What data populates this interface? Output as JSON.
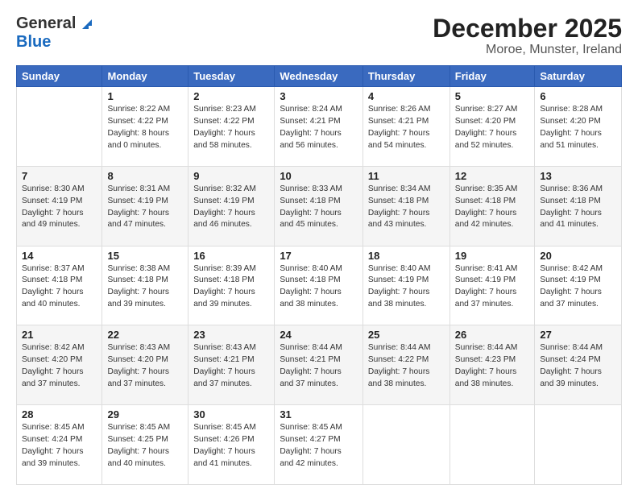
{
  "header": {
    "logo": {
      "line1": "General",
      "line2": "Blue"
    },
    "title": "December 2025",
    "location": "Moroe, Munster, Ireland"
  },
  "weekdays": [
    "Sunday",
    "Monday",
    "Tuesday",
    "Wednesday",
    "Thursday",
    "Friday",
    "Saturday"
  ],
  "weeks": [
    [
      {
        "day": "",
        "info": ""
      },
      {
        "day": "1",
        "info": "Sunrise: 8:22 AM\nSunset: 4:22 PM\nDaylight: 8 hours\nand 0 minutes."
      },
      {
        "day": "2",
        "info": "Sunrise: 8:23 AM\nSunset: 4:22 PM\nDaylight: 7 hours\nand 58 minutes."
      },
      {
        "day": "3",
        "info": "Sunrise: 8:24 AM\nSunset: 4:21 PM\nDaylight: 7 hours\nand 56 minutes."
      },
      {
        "day": "4",
        "info": "Sunrise: 8:26 AM\nSunset: 4:21 PM\nDaylight: 7 hours\nand 54 minutes."
      },
      {
        "day": "5",
        "info": "Sunrise: 8:27 AM\nSunset: 4:20 PM\nDaylight: 7 hours\nand 52 minutes."
      },
      {
        "day": "6",
        "info": "Sunrise: 8:28 AM\nSunset: 4:20 PM\nDaylight: 7 hours\nand 51 minutes."
      }
    ],
    [
      {
        "day": "7",
        "info": "Sunrise: 8:30 AM\nSunset: 4:19 PM\nDaylight: 7 hours\nand 49 minutes."
      },
      {
        "day": "8",
        "info": "Sunrise: 8:31 AM\nSunset: 4:19 PM\nDaylight: 7 hours\nand 47 minutes."
      },
      {
        "day": "9",
        "info": "Sunrise: 8:32 AM\nSunset: 4:19 PM\nDaylight: 7 hours\nand 46 minutes."
      },
      {
        "day": "10",
        "info": "Sunrise: 8:33 AM\nSunset: 4:18 PM\nDaylight: 7 hours\nand 45 minutes."
      },
      {
        "day": "11",
        "info": "Sunrise: 8:34 AM\nSunset: 4:18 PM\nDaylight: 7 hours\nand 43 minutes."
      },
      {
        "day": "12",
        "info": "Sunrise: 8:35 AM\nSunset: 4:18 PM\nDaylight: 7 hours\nand 42 minutes."
      },
      {
        "day": "13",
        "info": "Sunrise: 8:36 AM\nSunset: 4:18 PM\nDaylight: 7 hours\nand 41 minutes."
      }
    ],
    [
      {
        "day": "14",
        "info": "Sunrise: 8:37 AM\nSunset: 4:18 PM\nDaylight: 7 hours\nand 40 minutes."
      },
      {
        "day": "15",
        "info": "Sunrise: 8:38 AM\nSunset: 4:18 PM\nDaylight: 7 hours\nand 39 minutes."
      },
      {
        "day": "16",
        "info": "Sunrise: 8:39 AM\nSunset: 4:18 PM\nDaylight: 7 hours\nand 39 minutes."
      },
      {
        "day": "17",
        "info": "Sunrise: 8:40 AM\nSunset: 4:18 PM\nDaylight: 7 hours\nand 38 minutes."
      },
      {
        "day": "18",
        "info": "Sunrise: 8:40 AM\nSunset: 4:19 PM\nDaylight: 7 hours\nand 38 minutes."
      },
      {
        "day": "19",
        "info": "Sunrise: 8:41 AM\nSunset: 4:19 PM\nDaylight: 7 hours\nand 37 minutes."
      },
      {
        "day": "20",
        "info": "Sunrise: 8:42 AM\nSunset: 4:19 PM\nDaylight: 7 hours\nand 37 minutes."
      }
    ],
    [
      {
        "day": "21",
        "info": "Sunrise: 8:42 AM\nSunset: 4:20 PM\nDaylight: 7 hours\nand 37 minutes."
      },
      {
        "day": "22",
        "info": "Sunrise: 8:43 AM\nSunset: 4:20 PM\nDaylight: 7 hours\nand 37 minutes."
      },
      {
        "day": "23",
        "info": "Sunrise: 8:43 AM\nSunset: 4:21 PM\nDaylight: 7 hours\nand 37 minutes."
      },
      {
        "day": "24",
        "info": "Sunrise: 8:44 AM\nSunset: 4:21 PM\nDaylight: 7 hours\nand 37 minutes."
      },
      {
        "day": "25",
        "info": "Sunrise: 8:44 AM\nSunset: 4:22 PM\nDaylight: 7 hours\nand 38 minutes."
      },
      {
        "day": "26",
        "info": "Sunrise: 8:44 AM\nSunset: 4:23 PM\nDaylight: 7 hours\nand 38 minutes."
      },
      {
        "day": "27",
        "info": "Sunrise: 8:44 AM\nSunset: 4:24 PM\nDaylight: 7 hours\nand 39 minutes."
      }
    ],
    [
      {
        "day": "28",
        "info": "Sunrise: 8:45 AM\nSunset: 4:24 PM\nDaylight: 7 hours\nand 39 minutes."
      },
      {
        "day": "29",
        "info": "Sunrise: 8:45 AM\nSunset: 4:25 PM\nDaylight: 7 hours\nand 40 minutes."
      },
      {
        "day": "30",
        "info": "Sunrise: 8:45 AM\nSunset: 4:26 PM\nDaylight: 7 hours\nand 41 minutes."
      },
      {
        "day": "31",
        "info": "Sunrise: 8:45 AM\nSunset: 4:27 PM\nDaylight: 7 hours\nand 42 minutes."
      },
      {
        "day": "",
        "info": ""
      },
      {
        "day": "",
        "info": ""
      },
      {
        "day": "",
        "info": ""
      }
    ]
  ]
}
